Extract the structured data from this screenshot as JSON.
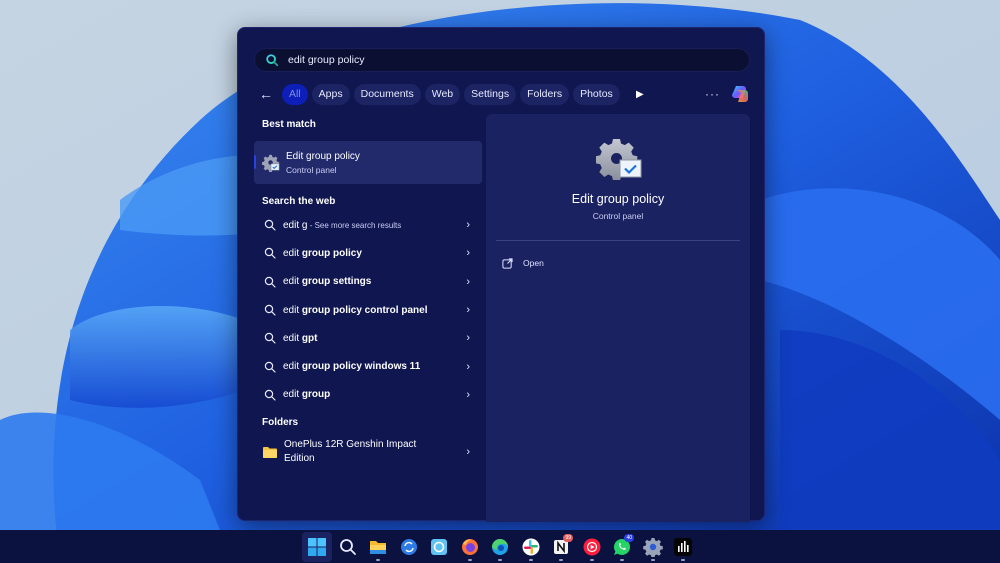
{
  "search": {
    "query": "edit group policy",
    "placeholder": ""
  },
  "filters": {
    "back_icon": "arrow-left-icon",
    "items": [
      {
        "label": "All",
        "active": true
      },
      {
        "label": "Apps"
      },
      {
        "label": "Documents"
      },
      {
        "label": "Web"
      },
      {
        "label": "Settings"
      },
      {
        "label": "Folders"
      },
      {
        "label": "Photos"
      }
    ],
    "more_label": "···",
    "play_icon": "▶"
  },
  "best_match": {
    "header": "Best match",
    "title": "Edit group policy",
    "subtitle": "Control panel"
  },
  "web": {
    "header": "Search the web",
    "items": [
      {
        "prefix": "edit g",
        "bold": "",
        "hint": " - See more search results"
      },
      {
        "prefix": "edit ",
        "bold": "group policy",
        "hint": ""
      },
      {
        "prefix": "edit ",
        "bold": "group settings",
        "hint": ""
      },
      {
        "prefix": "edit ",
        "bold": "group policy control panel",
        "hint": ""
      },
      {
        "prefix": "edit ",
        "bold": "gpt",
        "hint": ""
      },
      {
        "prefix": "edit ",
        "bold": "group policy windows 11",
        "hint": ""
      },
      {
        "prefix": "edit ",
        "bold": "group",
        "hint": ""
      }
    ]
  },
  "folders": {
    "header": "Folders",
    "items": [
      {
        "label": "OnePlus 12R Genshin Impact Edition"
      }
    ]
  },
  "detail": {
    "title": "Edit group policy",
    "subtitle": "Control panel",
    "actions": [
      {
        "label": "Open"
      }
    ]
  },
  "taskbar": {
    "items": [
      {
        "name": "start",
        "icon": "windows-logo-icon"
      },
      {
        "name": "search",
        "icon": "search-icon"
      },
      {
        "name": "file-explorer",
        "icon": "folder-icon",
        "running": true
      },
      {
        "name": "app-sync",
        "icon": "sync-icon"
      },
      {
        "name": "app-quick-assist",
        "icon": "quick-assist-icon"
      },
      {
        "name": "firefox",
        "icon": "firefox-icon",
        "running": true
      },
      {
        "name": "edge",
        "icon": "edge-icon",
        "running": true
      },
      {
        "name": "slack",
        "icon": "slack-icon",
        "running": true
      },
      {
        "name": "notion",
        "icon": "notion-icon",
        "running": true,
        "badge": "99"
      },
      {
        "name": "youtube-music",
        "icon": "youtube-music-icon",
        "running": true
      },
      {
        "name": "whatsapp",
        "icon": "whatsapp-icon",
        "running": true,
        "badge": "40"
      },
      {
        "name": "settings",
        "icon": "gear-icon",
        "running": true
      },
      {
        "name": "audio-app",
        "icon": "equalizer-icon",
        "running": true
      }
    ]
  }
}
